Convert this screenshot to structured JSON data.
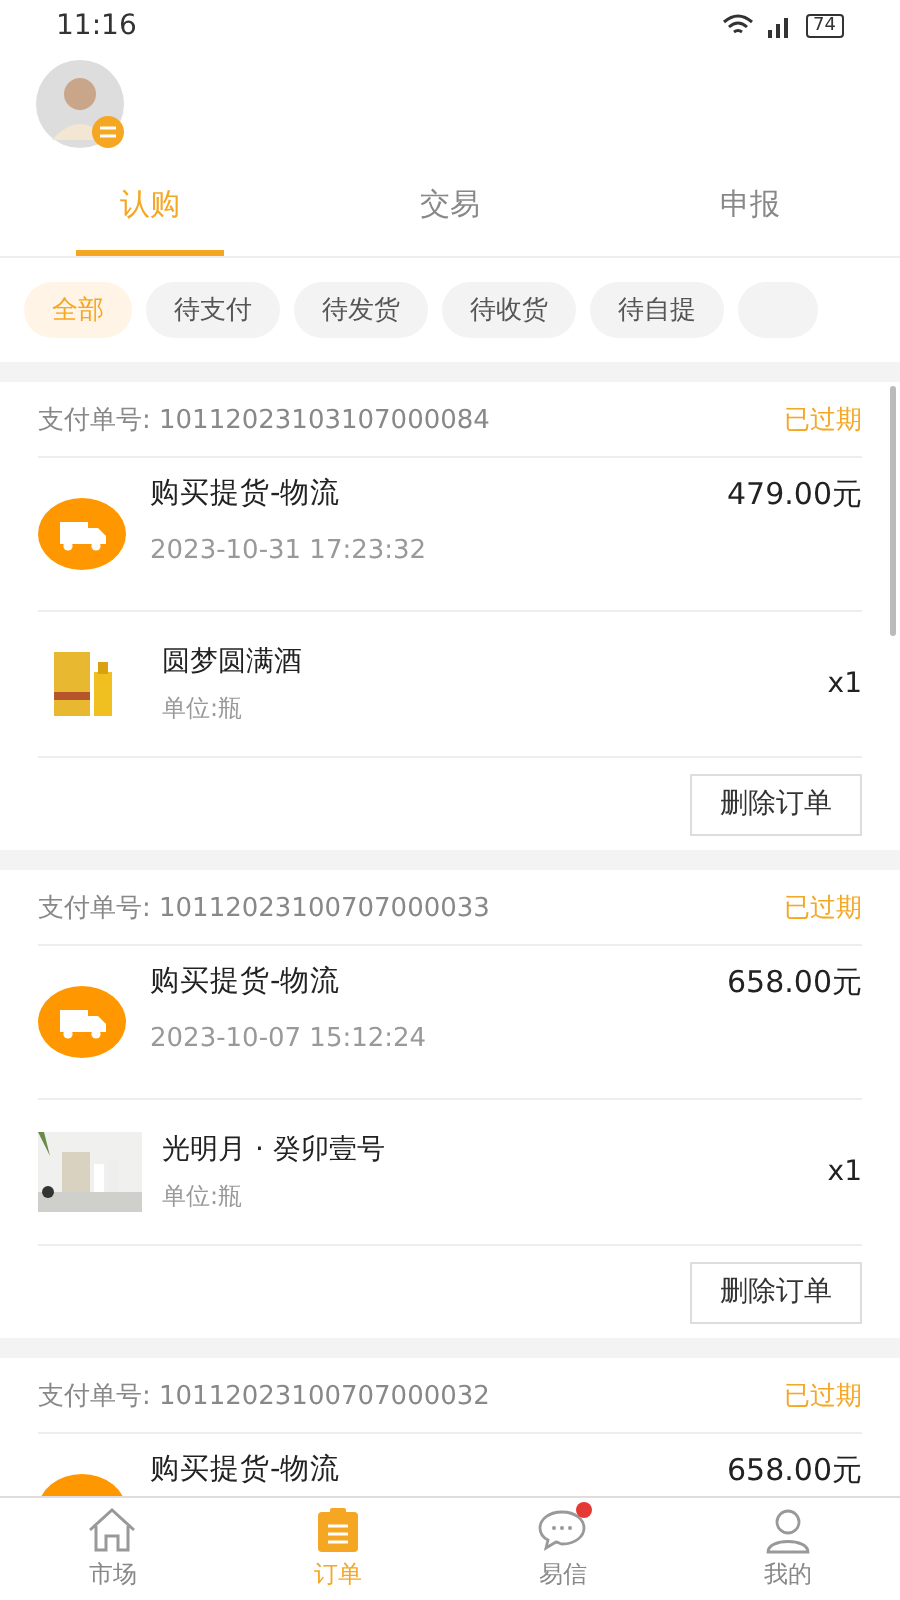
{
  "status_bar": {
    "time": "11:16",
    "battery": "74"
  },
  "tabs": [
    {
      "label": "认购",
      "selected": true
    },
    {
      "label": "交易",
      "selected": false
    },
    {
      "label": "申报",
      "selected": false
    }
  ],
  "filters": [
    {
      "label": "全部",
      "selected": true
    },
    {
      "label": "待支付",
      "selected": false
    },
    {
      "label": "待发货",
      "selected": false
    },
    {
      "label": "待收货",
      "selected": false
    },
    {
      "label": "待自提",
      "selected": false
    }
  ],
  "orders": [
    {
      "order_no": "支付单号: 10112023103107000084",
      "status": "已过期",
      "title": "购买提货-物流",
      "amount": "479.00元",
      "time": "2023-10-31 17:23:32",
      "product": {
        "name": "圆梦圆满酒",
        "unit": "单位:瓶",
        "qty": "x1",
        "kind": "picture"
      },
      "action": "删除订单"
    },
    {
      "order_no": "支付单号: 10112023100707000033",
      "status": "已过期",
      "title": "购买提货-物流",
      "amount": "658.00元",
      "time": "2023-10-07 15:12:24",
      "product": {
        "name": "光明月 · 癸卯壹号",
        "unit": "单位:瓶",
        "qty": "x1",
        "kind": "picture"
      },
      "action": "删除订单"
    },
    {
      "order_no": "支付单号: 10112023100707000032",
      "status": "已过期",
      "title": "购买提货-物流",
      "amount": "658.00元"
    }
  ],
  "bottom_nav": [
    {
      "label": "市场",
      "kind": "home",
      "selected": false,
      "badge": false
    },
    {
      "label": "订单",
      "kind": "orders",
      "selected": true,
      "badge": false
    },
    {
      "label": "易信",
      "kind": "chat",
      "selected": false,
      "badge": true
    },
    {
      "label": "我的",
      "kind": "profile",
      "selected": false,
      "badge": false
    }
  ]
}
